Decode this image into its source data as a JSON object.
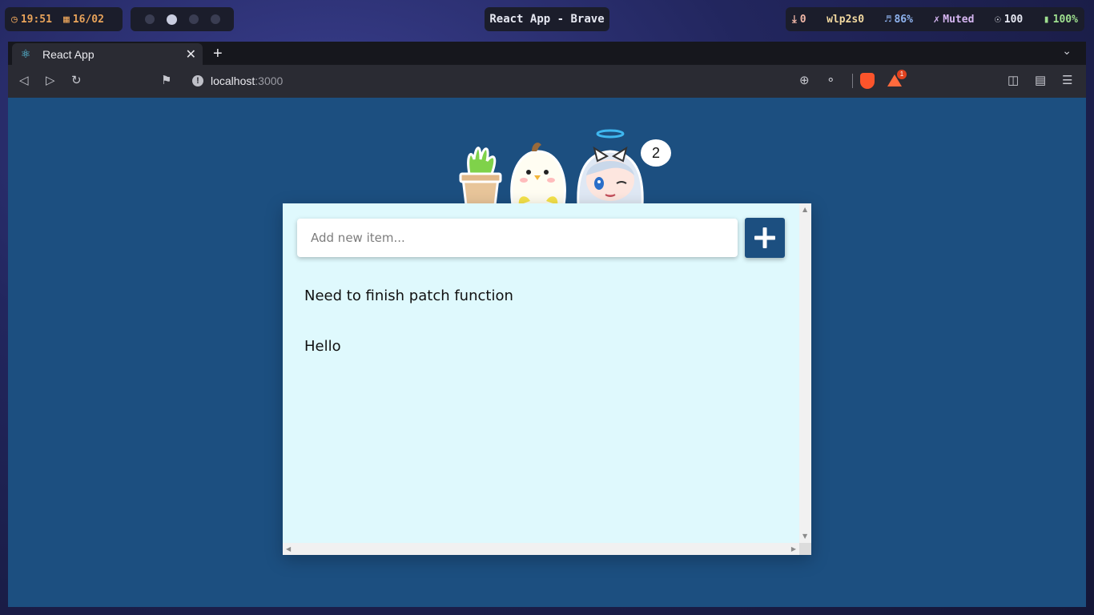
{
  "status_bar": {
    "time": "19:51",
    "date": "16/02",
    "window_title": "React App - Brave",
    "downloads": "0",
    "network": "wlp2s0",
    "volume": "86%",
    "mic": "Muted",
    "brightness": "100",
    "battery": "100%",
    "workspaces": [
      false,
      true,
      false,
      false
    ]
  },
  "browser": {
    "tab_title": "React App",
    "url_host": "localhost",
    "url_port": ":3000",
    "rewards_badge": "1"
  },
  "app": {
    "input_placeholder": "Add new item...",
    "notification_count": "2",
    "items": [
      "Need to finish patch function",
      "Hello"
    ]
  },
  "colors": {
    "page_background": "#1c4f80",
    "card_background": "#dff9fd",
    "accent": "#1c4f80"
  }
}
